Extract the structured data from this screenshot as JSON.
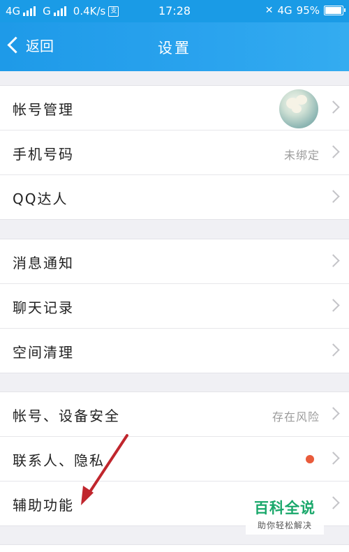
{
  "status_bar": {
    "network1": "4G",
    "network2": "G",
    "speed": "0.4K/s",
    "notify_glyph": "支",
    "time": "17:28",
    "lte_badge": "4G",
    "battery": "95%",
    "battery_level": 0.95
  },
  "nav": {
    "back_label": "返回",
    "title": "设置"
  },
  "groups": [
    {
      "rows": [
        {
          "label": "帐号管理",
          "value": "",
          "has_avatar": true
        },
        {
          "label": "手机号码",
          "value": "未绑定"
        },
        {
          "label": "QQ达人",
          "value": ""
        }
      ]
    },
    {
      "rows": [
        {
          "label": "消息通知",
          "value": ""
        },
        {
          "label": "聊天记录",
          "value": ""
        },
        {
          "label": "空间清理",
          "value": ""
        }
      ]
    },
    {
      "rows": [
        {
          "label": "帐号、设备安全",
          "value": "存在风险"
        },
        {
          "label": "联系人、隐私",
          "value": "",
          "has_dot": true
        },
        {
          "label": "辅助功能",
          "value": ""
        }
      ]
    }
  ],
  "watermark": {
    "main": "百科全说",
    "sub": "助你轻松解决"
  },
  "colors": {
    "nav_bar": "#1e9ae8",
    "status_bar": "#1a9be6",
    "red_dot": "#e95b3b",
    "annotation_arrow": "#c0262d",
    "watermark_green": "#1aa86b"
  }
}
